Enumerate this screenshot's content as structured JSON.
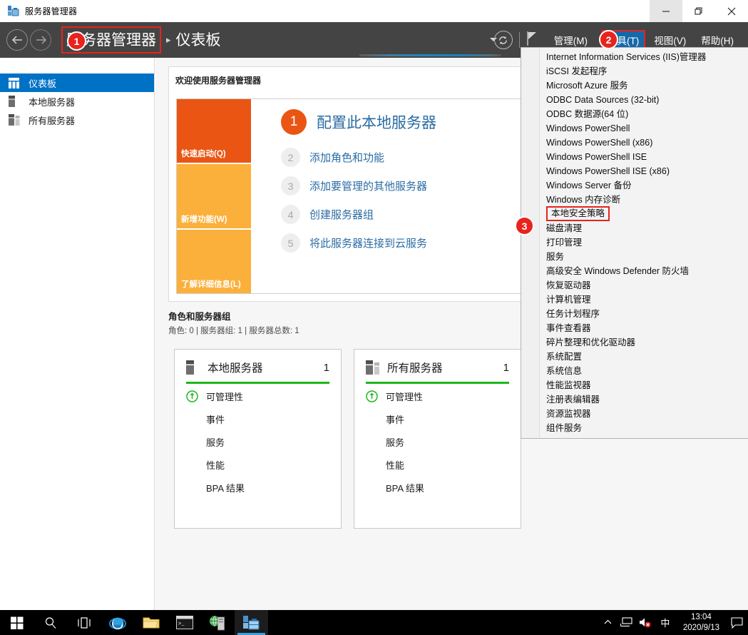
{
  "window": {
    "title": "服务器管理器",
    "icon": "server-manager-icon",
    "minimize_label": "—",
    "maximize_label": "❐",
    "close_label": "✕"
  },
  "header": {
    "back_icon": "back-arrow-icon",
    "forward_icon": "forward-arrow-icon",
    "breadcrumb_root": "服务器管理器",
    "breadcrumb_separator": "▸",
    "breadcrumb_leaf": "仪表板",
    "search_caret_icon": "chevron-down-icon",
    "refresh_icon": "refresh-icon",
    "flag_icon": "flag-icon",
    "menu": [
      {
        "label": "管理(M)",
        "active": false
      },
      {
        "label": "工具(T)",
        "active": true
      },
      {
        "label": "视图(V)",
        "active": false
      },
      {
        "label": "帮助(H)",
        "active": false
      }
    ]
  },
  "sidebar": {
    "items": [
      {
        "label": "仪表板",
        "icon": "dashboard-icon",
        "selected": true
      },
      {
        "label": "本地服务器",
        "icon": "local-server-icon",
        "selected": false
      },
      {
        "label": "所有服务器",
        "icon": "all-servers-icon",
        "selected": false
      }
    ]
  },
  "welcome": {
    "title": "欢迎使用服务器管理器",
    "tiles": [
      {
        "label": "快速启动(Q)",
        "color": "#ea5514"
      },
      {
        "label": "新增功能(W)",
        "color": "#fbb03b"
      },
      {
        "label": "了解详细信息(L)",
        "color": "#fbb03b"
      }
    ],
    "steps": [
      {
        "num": "1",
        "text": "配置此本地服务器",
        "primary": true
      },
      {
        "num": "2",
        "text": "添加角色和功能",
        "primary": false
      },
      {
        "num": "3",
        "text": "添加要管理的其他服务器",
        "primary": false
      },
      {
        "num": "4",
        "text": "创建服务器组",
        "primary": false
      },
      {
        "num": "5",
        "text": "将此服务器连接到云服务",
        "primary": false
      }
    ]
  },
  "roles_section": {
    "title": "角色和服务器组",
    "summary": "角色: 0 | 服务器组: 1 | 服务器总数: 1",
    "cards": [
      {
        "name": "本地服务器",
        "icon": "local-server-icon",
        "count": "1",
        "rows": [
          {
            "label": "可管理性",
            "status_icon": "manageability-ok-icon"
          },
          {
            "label": "事件",
            "status_icon": ""
          },
          {
            "label": "服务",
            "status_icon": ""
          },
          {
            "label": "性能",
            "status_icon": ""
          },
          {
            "label": "BPA 结果",
            "status_icon": ""
          }
        ]
      },
      {
        "name": "所有服务器",
        "icon": "all-servers-icon",
        "count": "1",
        "rows": [
          {
            "label": "可管理性",
            "status_icon": "manageability-ok-icon"
          },
          {
            "label": "事件",
            "status_icon": ""
          },
          {
            "label": "服务",
            "status_icon": ""
          },
          {
            "label": "性能",
            "status_icon": ""
          },
          {
            "label": "BPA 结果",
            "status_icon": ""
          }
        ]
      }
    ]
  },
  "tools_menu": {
    "items": [
      {
        "label": "Internet Information Services (IIS)管理器",
        "highlighted": false
      },
      {
        "label": "iSCSI 发起程序",
        "highlighted": false
      },
      {
        "label": "Microsoft Azure 服务",
        "highlighted": false
      },
      {
        "label": "ODBC Data Sources (32-bit)",
        "highlighted": false
      },
      {
        "label": "ODBC 数据源(64 位)",
        "highlighted": false
      },
      {
        "label": "Windows PowerShell",
        "highlighted": false
      },
      {
        "label": "Windows PowerShell (x86)",
        "highlighted": false
      },
      {
        "label": "Windows PowerShell ISE",
        "highlighted": false
      },
      {
        "label": "Windows PowerShell ISE (x86)",
        "highlighted": false
      },
      {
        "label": "Windows Server 备份",
        "highlighted": false
      },
      {
        "label": "Windows 内存诊断",
        "highlighted": false
      },
      {
        "label": "本地安全策略",
        "highlighted": true
      },
      {
        "label": "磁盘清理",
        "highlighted": false
      },
      {
        "label": "打印管理",
        "highlighted": false
      },
      {
        "label": "服务",
        "highlighted": false
      },
      {
        "label": "高级安全 Windows Defender 防火墙",
        "highlighted": false
      },
      {
        "label": "恢复驱动器",
        "highlighted": false
      },
      {
        "label": "计算机管理",
        "highlighted": false
      },
      {
        "label": "任务计划程序",
        "highlighted": false
      },
      {
        "label": "事件查看器",
        "highlighted": false
      },
      {
        "label": "碎片整理和优化驱动器",
        "highlighted": false
      },
      {
        "label": "系统配置",
        "highlighted": false
      },
      {
        "label": "系统信息",
        "highlighted": false
      },
      {
        "label": "性能监视器",
        "highlighted": false
      },
      {
        "label": "注册表编辑器",
        "highlighted": false
      },
      {
        "label": "资源监视器",
        "highlighted": false
      },
      {
        "label": "组件服务",
        "highlighted": false
      }
    ]
  },
  "annotations": {
    "accent_color": "#e8231e",
    "badges": [
      {
        "number": "1",
        "target": "breadcrumb-root"
      },
      {
        "number": "2",
        "target": "tools-menu-button"
      },
      {
        "number": "3",
        "target": "local-security-policy-item"
      }
    ]
  },
  "taskbar": {
    "items": [
      {
        "icon": "windows-start-icon",
        "name": "start-button",
        "active": false
      },
      {
        "icon": "search-icon",
        "name": "taskbar-search",
        "active": false
      },
      {
        "icon": "task-view-icon",
        "name": "task-view-button",
        "active": false
      },
      {
        "icon": "internet-explorer-icon",
        "name": "taskbar-internet-explorer",
        "active": false
      },
      {
        "icon": "file-explorer-icon",
        "name": "taskbar-file-explorer",
        "active": false
      },
      {
        "icon": "command-prompt-icon",
        "name": "taskbar-command-prompt",
        "active": false
      },
      {
        "icon": "network-server-icon",
        "name": "taskbar-network-server",
        "active": false
      },
      {
        "icon": "server-manager-icon",
        "name": "taskbar-server-manager",
        "active": true
      }
    ],
    "tray": {
      "chevron_icon": "show-hidden-icons-chevron",
      "network_icon": "network-icon",
      "volume_icon": "volume-muted-icon",
      "ime_label": "中",
      "time": "13:04",
      "date": "2020/9/13",
      "action_center_icon": "action-center-icon"
    }
  }
}
